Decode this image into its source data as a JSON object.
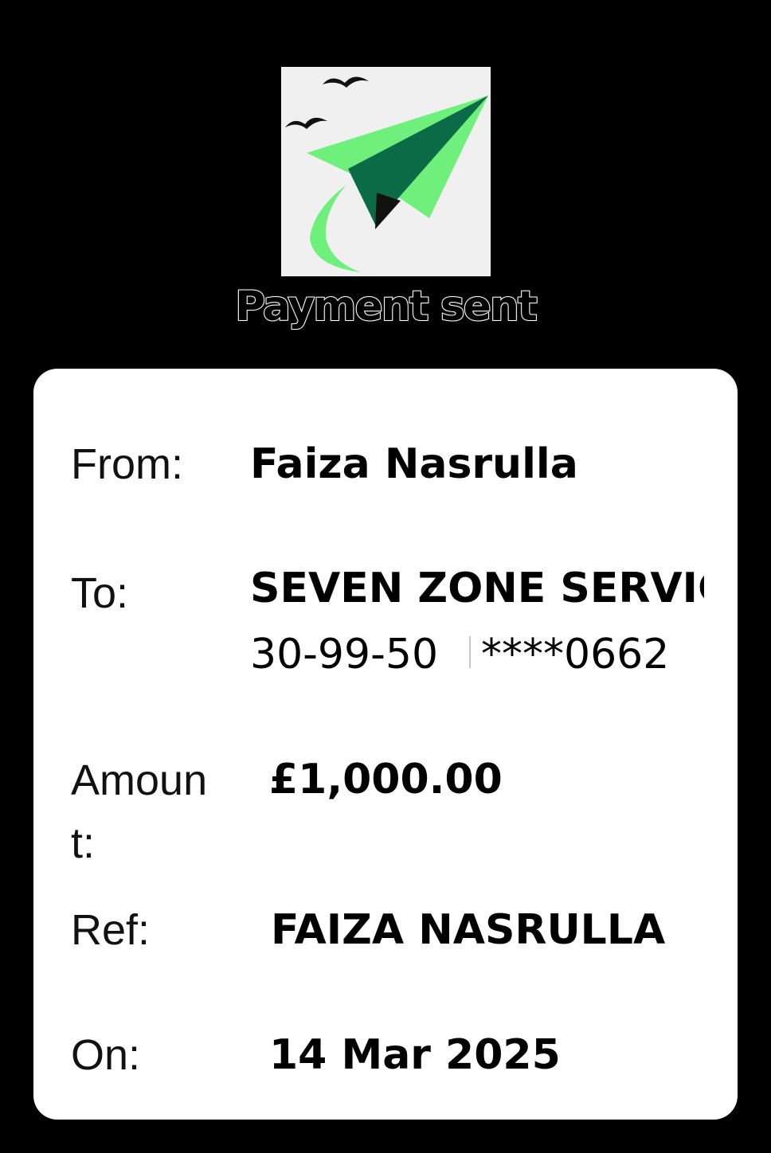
{
  "header": {
    "logo_icon": "paper-plane-birds-icon",
    "status": "Payment sent"
  },
  "colors": {
    "background": "#000000",
    "card": "#ffffff",
    "plane_light": "#6ff07c",
    "plane_dark": "#0b6b47"
  },
  "details": {
    "from_label": "From:",
    "from_value": "Faiza Nasrulla",
    "to_label": "To:",
    "to_value": "SEVEN ZONE SERVIC",
    "sort_code": "30-99-50",
    "account": "****0662",
    "amount_label_1": "Amoun",
    "amount_label_2": "t:",
    "amount_value": "£1,000.00",
    "ref_label": "Ref:",
    "ref_value": "FAIZA NASRULLA",
    "on_label": "On:",
    "on_value": "14 Mar 2025"
  }
}
